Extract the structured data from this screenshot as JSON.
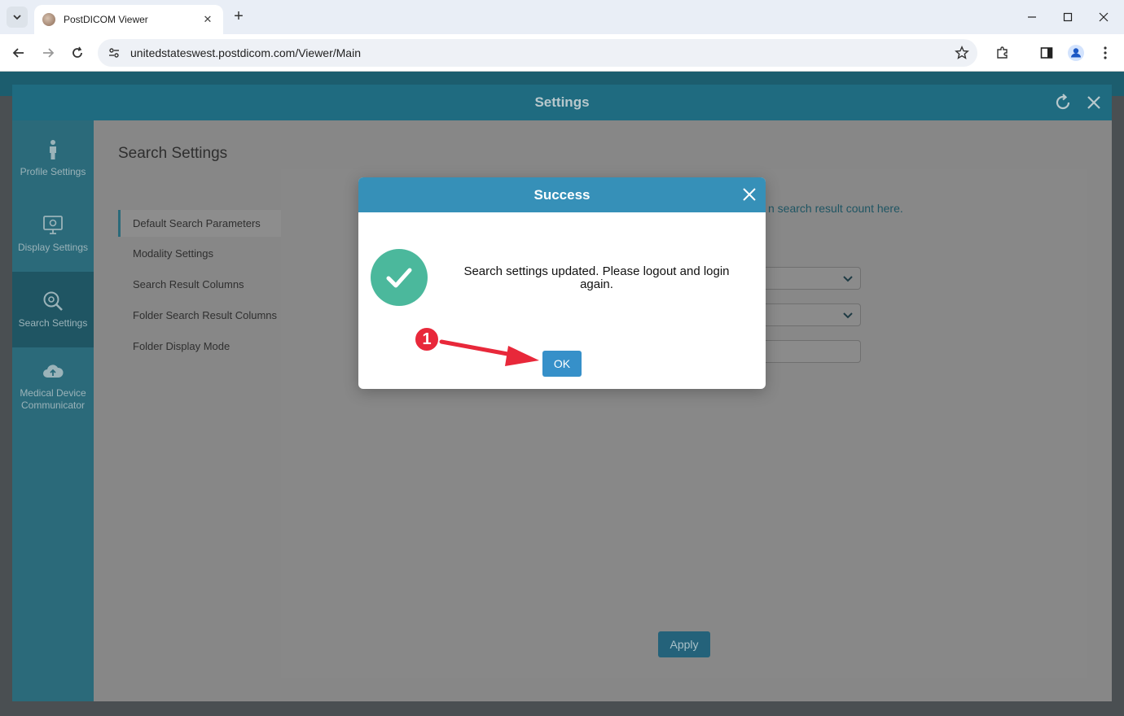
{
  "browser": {
    "tab_title": "PostDICOM Viewer",
    "new_tab_symbol": "+",
    "url": "unitedstateswest.postdicom.com/Viewer/Main",
    "tab_close_symbol": "✕"
  },
  "settings": {
    "title": "Settings",
    "sidebar": [
      {
        "label": "Profile Settings",
        "icon": "person-icon"
      },
      {
        "label": "Display Settings",
        "icon": "monitor-icon"
      },
      {
        "label": "Search Settings",
        "icon": "search-gear-icon"
      },
      {
        "label": "Medical Device Communicator",
        "icon": "cloud-icon"
      }
    ],
    "content_title": "Search Settings",
    "submenu": [
      "Default Search Parameters",
      "Modality Settings",
      "Search Result Columns",
      "Folder Search Result Columns",
      "Folder Display Mode"
    ],
    "hint_text": "n search result count here.",
    "apply_label": "Apply"
  },
  "dialog": {
    "title": "Success",
    "message": "Search settings updated. Please logout and login again.",
    "ok_label": "OK"
  },
  "annotation": {
    "step": "1"
  },
  "colors": {
    "dialog_header": "#3690b8",
    "success_green": "#4bb89c",
    "ok_button": "#3690c9",
    "annotation_red": "#e8283a"
  }
}
